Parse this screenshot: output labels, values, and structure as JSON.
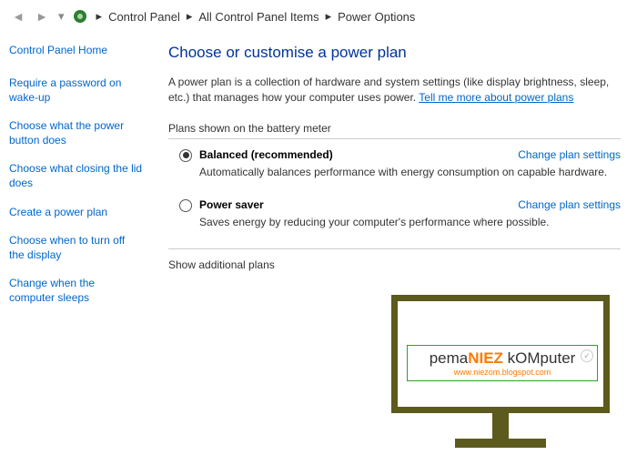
{
  "breadcrumb": {
    "item1": "Control Panel",
    "item2": "All Control Panel Items",
    "item3": "Power Options"
  },
  "sidebar": {
    "home": "Control Panel Home",
    "links": [
      "Require a password on wake-up",
      "Choose what the power button does",
      "Choose what closing the lid does",
      "Create a power plan",
      "Choose when to turn off the display",
      "Change when the computer sleeps"
    ]
  },
  "main": {
    "heading": "Choose or customise a power plan",
    "description_pre": "A power plan is a collection of hardware and system settings (like display brightness, sleep, etc.) that manages how your computer uses power. ",
    "description_link": "Tell me more about power plans",
    "section_label": "Plans shown on the battery meter",
    "plans": [
      {
        "name": "Balanced (recommended)",
        "desc": "Automatically balances performance with energy consumption on capable hardware.",
        "link": "Change plan settings",
        "selected": true
      },
      {
        "name": "Power saver",
        "desc": "Saves energy by reducing your computer's performance where possible.",
        "link": "Change plan settings",
        "selected": false
      }
    ],
    "show_additional": "Show additional plans"
  },
  "watermark": {
    "brand_p1": "pema",
    "brand_p2": "NIEZ",
    "brand_p3": " kOMputer",
    "url": "www.niezom.blogspot.com"
  }
}
